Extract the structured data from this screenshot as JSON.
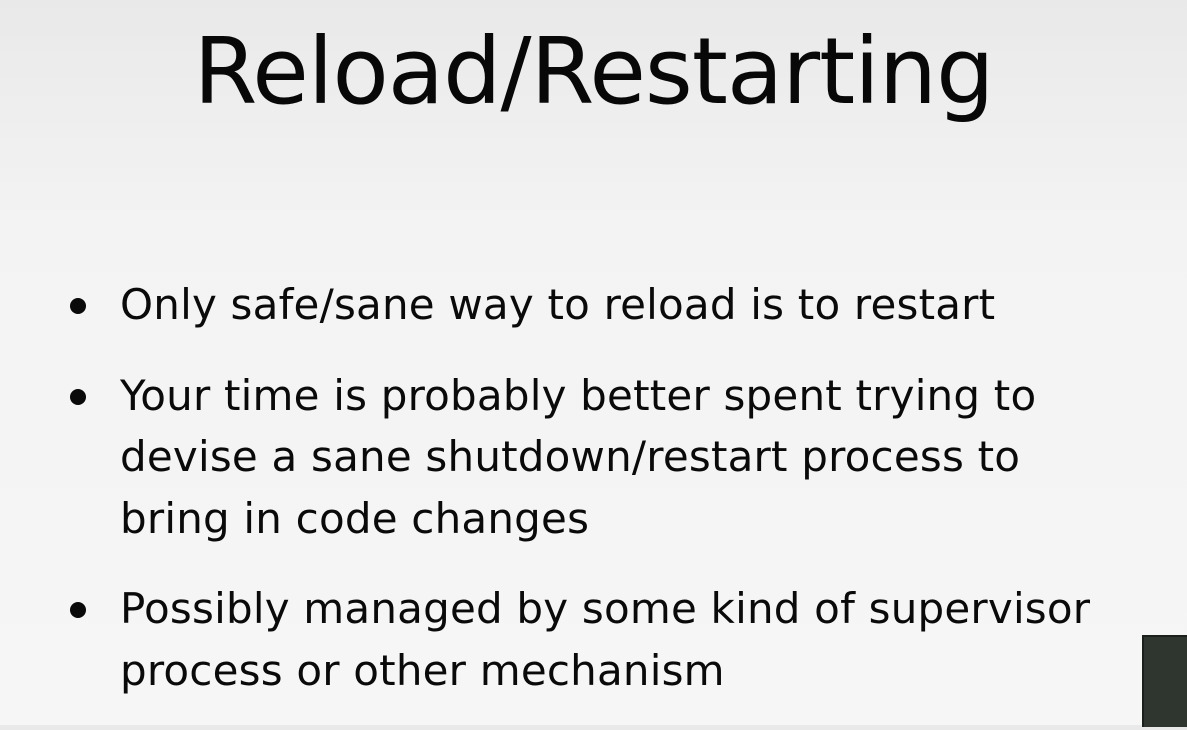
{
  "slide": {
    "title": "Reload/Restarting",
    "bullets": [
      {
        "text": "Only safe/sane way to reload is to restart"
      },
      {
        "text": "Your time is probably better spent trying to devise a sane shutdown/restart process to bring in code changes"
      },
      {
        "text": "Possibly managed by some kind of supervisor process or other mechanism"
      }
    ]
  }
}
